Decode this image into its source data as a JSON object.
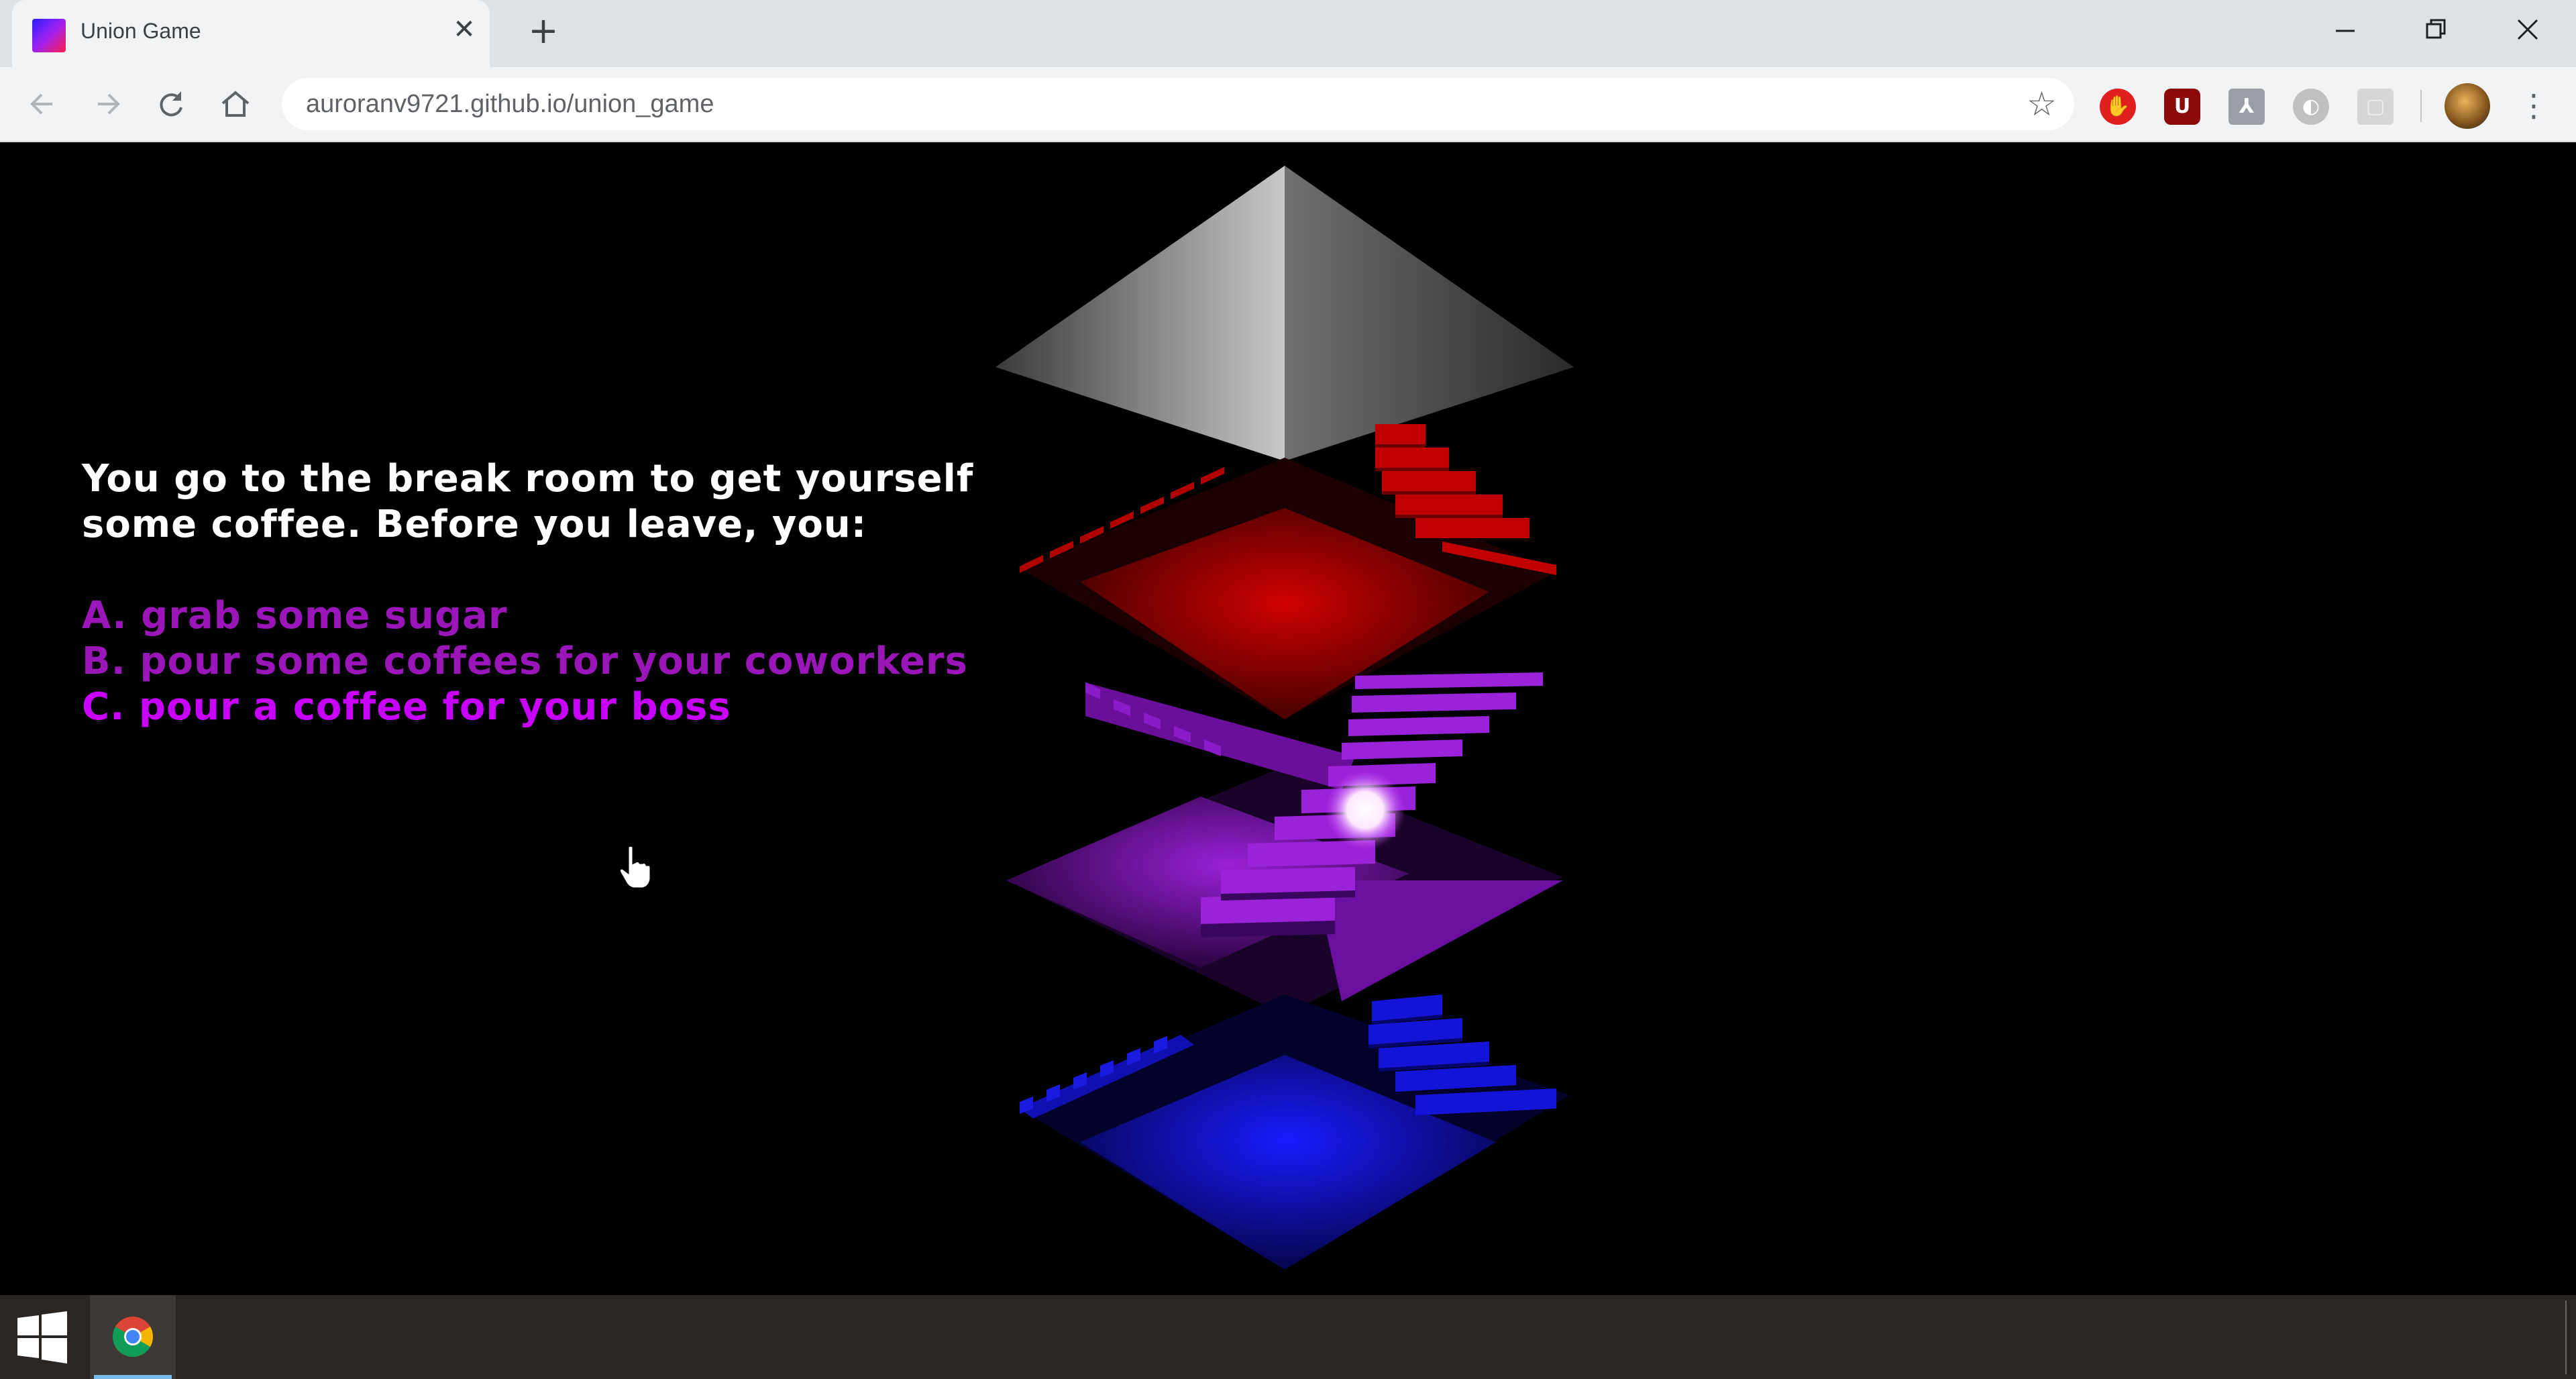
{
  "browser": {
    "tab_title": "Union Game",
    "url": "auroranv9721.github.io/union_game",
    "tab_close_glyph": "✕",
    "new_tab_glyph": "+",
    "icons": {
      "back": "back-arrow-icon",
      "forward": "forward-arrow-icon",
      "reload": "reload-icon",
      "home": "home-icon",
      "bookmark": "star-icon",
      "menu": "three-dots-icon"
    },
    "extensions": [
      {
        "name": "adblock-icon",
        "glyph": "✋",
        "color": "#e02020"
      },
      {
        "name": "ublock-icon",
        "glyph": "U",
        "color": "#8b0000"
      },
      {
        "name": "pdf-icon",
        "glyph": "⅄",
        "color": "#9aa0a6"
      },
      {
        "name": "grey-extension-icon",
        "glyph": "◐",
        "color": "#b0b0b0"
      },
      {
        "name": "pocket-icon",
        "glyph": "▢",
        "color": "#c8c8c8"
      }
    ]
  },
  "game": {
    "prompt_line1": "You go to the break room to get yourself",
    "prompt_line2": "some coffee. Before you leave, you:",
    "choices": [
      {
        "label": "A. grab some sugar"
      },
      {
        "label": "B. pour some coffees for your coworkers"
      },
      {
        "label": "C. pour a coffee for your boss"
      }
    ],
    "hovered_choice_index": 2,
    "colors": {
      "text": "#ffffff",
      "choice": "#9a16b8",
      "choice_hover": "#c800ff",
      "red_floor": "#a00000",
      "purple_floor": "#7a14a8",
      "blue_floor": "#1010c8",
      "pyramid": "#9a9a9a"
    }
  },
  "taskbar": {
    "start_icon": "windows-logo-icon",
    "pinned": [
      "chrome-icon"
    ]
  }
}
